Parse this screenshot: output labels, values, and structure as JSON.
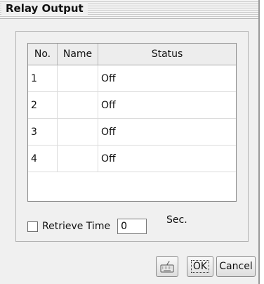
{
  "window": {
    "title": "Relay Output"
  },
  "table": {
    "headers": {
      "no": "No.",
      "name": "Name",
      "status": "Status"
    },
    "rows": [
      {
        "no": "1",
        "name": "",
        "status": "Off"
      },
      {
        "no": "2",
        "name": "",
        "status": "Off"
      },
      {
        "no": "3",
        "name": "",
        "status": "Off"
      },
      {
        "no": "4",
        "name": "",
        "status": "Off"
      }
    ]
  },
  "retrieve": {
    "label": "Retrieve Time",
    "checked": false,
    "value": "0",
    "unit": "Sec."
  },
  "buttons": {
    "keyboard_icon": "keyboard-icon",
    "ok": "OK",
    "cancel": "Cancel"
  }
}
